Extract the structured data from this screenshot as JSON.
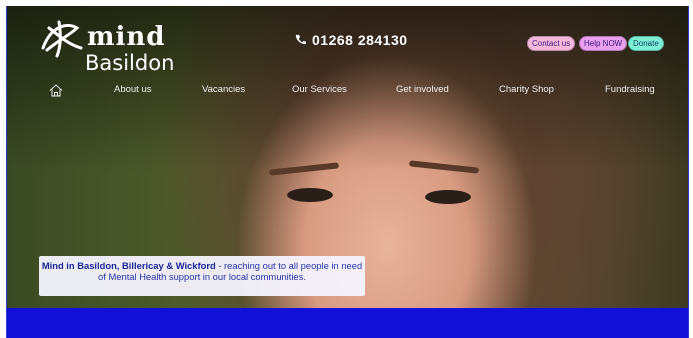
{
  "logo": {
    "mind": "mind",
    "town": "Basildon"
  },
  "header": {
    "phone_icon": "phone-icon",
    "phone": "01268 284130"
  },
  "actions": {
    "contact": "Contact us",
    "help": "Help NOW",
    "donate": "Donate"
  },
  "nav": {
    "home_icon": "home-icon",
    "items": [
      "About us",
      "Vacancies",
      "Our Services",
      "Get involved",
      "Charity Shop",
      "Fundraising"
    ]
  },
  "banner": {
    "bold": "Mind in Basildon, Billericay & Wickford",
    "text": " - reaching out to all people in need of Mental Health support in our local communities."
  },
  "colors": {
    "accent_blue": "#1010d8",
    "contact_bg": "#f5b8dc",
    "help_bg": "#eaa0f0",
    "donate_bg": "#7ef0d6"
  }
}
